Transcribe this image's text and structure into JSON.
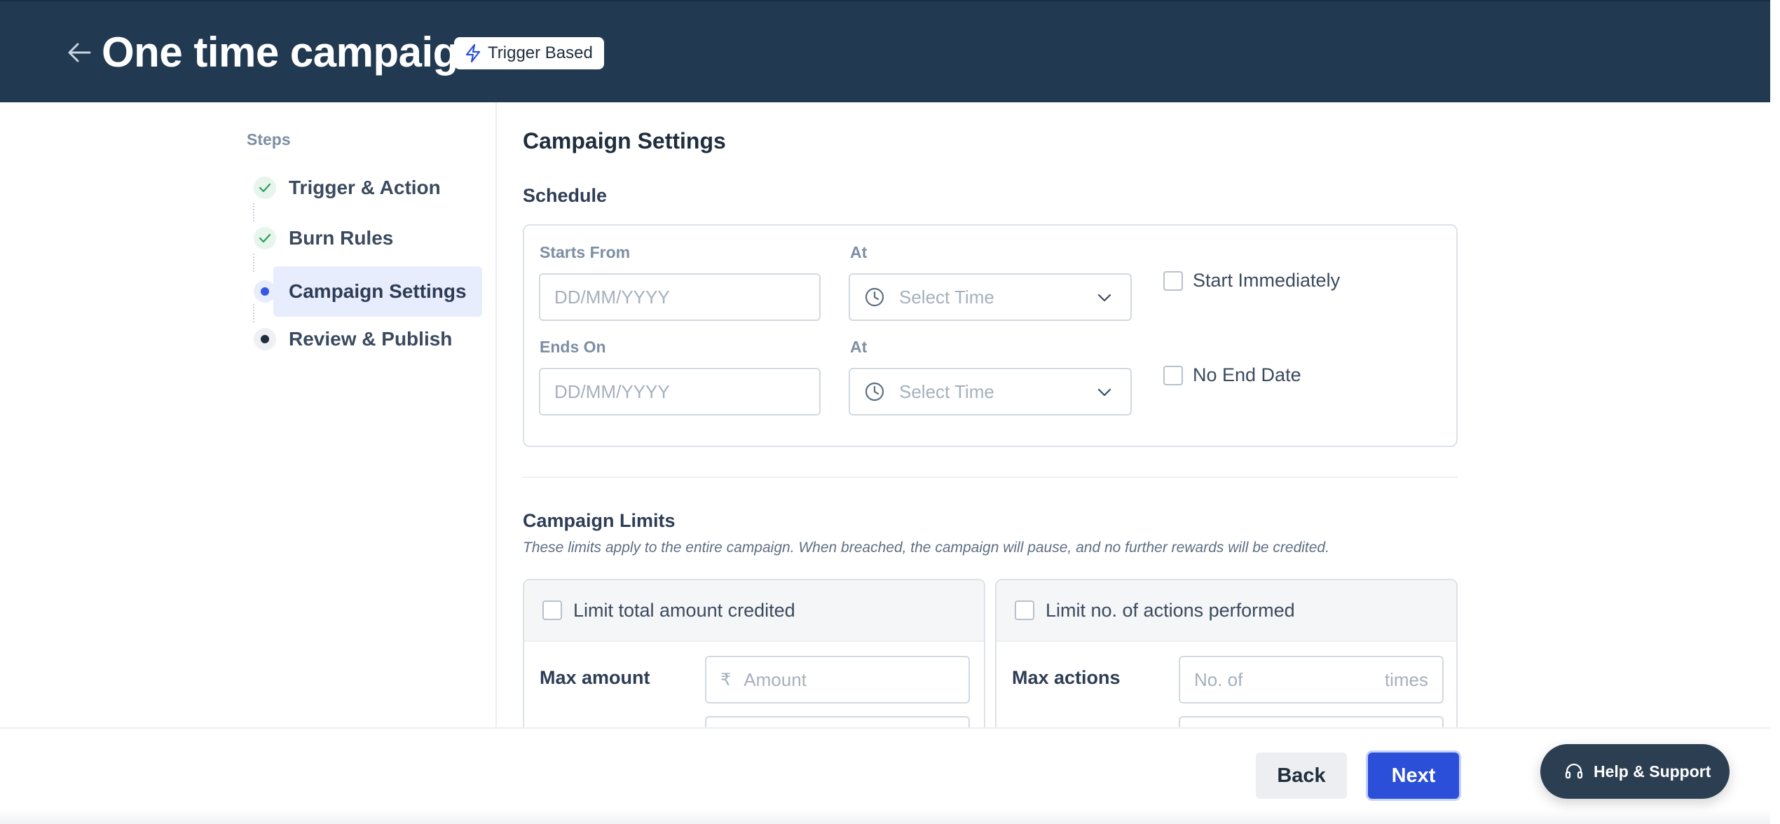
{
  "header": {
    "title": "One time campaign",
    "badge": "Trigger Based",
    "back_icon": "arrow-left-icon",
    "badge_icon": "lightning-icon",
    "bg_color": "#213a52"
  },
  "sidebar": {
    "heading": "Steps",
    "steps": [
      {
        "label": "Trigger & Action",
        "status": "completed"
      },
      {
        "label": "Burn Rules",
        "status": "completed"
      },
      {
        "label": "Campaign Settings",
        "status": "current"
      },
      {
        "label": "Review & Publish",
        "status": "pending"
      }
    ]
  },
  "main": {
    "title": "Campaign Settings",
    "schedule": {
      "title": "Schedule",
      "starts_from": {
        "label": "Starts From",
        "placeholder": "DD/MM/YYYY"
      },
      "start_time": {
        "label": "At",
        "placeholder": "Select Time"
      },
      "start_immediately": {
        "label": "Start Immediately",
        "checked": false
      },
      "ends_on": {
        "label": "Ends On",
        "placeholder": "DD/MM/YYYY"
      },
      "end_time": {
        "label": "At",
        "placeholder": "Select Time"
      },
      "no_end_date": {
        "label": "No End Date",
        "checked": false
      }
    },
    "limits": {
      "title": "Campaign Limits",
      "description": "These limits apply to the entire campaign. When breached, the campaign will pause, and no further rewards will be credited.",
      "amount_card": {
        "checkbox_label": "Limit total amount credited",
        "checked": false,
        "row_label": "Max amount",
        "currency": "₹",
        "placeholder": "Amount"
      },
      "actions_card": {
        "checkbox_label": "Limit no. of actions performed",
        "checked": false,
        "row_label": "Max actions",
        "placeholder": "No. of",
        "suffix": "times"
      }
    }
  },
  "footer": {
    "back_label": "Back",
    "next_label": "Next",
    "help_label": "Help & Support",
    "help_icon": "headset-icon",
    "accent_color": "#2b4fd8"
  }
}
